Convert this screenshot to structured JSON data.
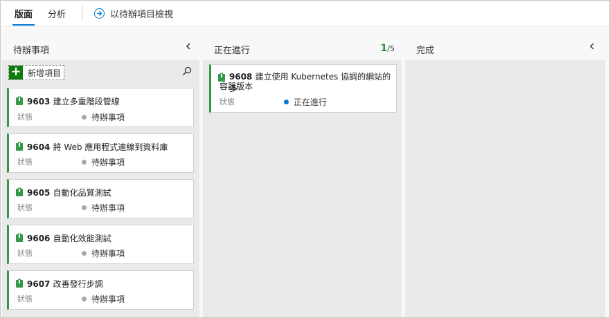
{
  "tabs": {
    "board": "版面",
    "analytics": "分析"
  },
  "backlog_link": {
    "label": "以待辦項目檢視",
    "icon": "arrow-circle-right-icon"
  },
  "columns": {
    "backlog": {
      "title": "待辦事項",
      "add_label": "新增項目"
    },
    "in_progress": {
      "title": "正在進行",
      "wip_current": "1",
      "wip_limit": "/5"
    },
    "done": {
      "title": "完成"
    }
  },
  "state_label": "狀態",
  "backlog_cards": [
    {
      "id": "9603",
      "title": "建立多重階段管線",
      "state": "待辦事項"
    },
    {
      "id": "9604",
      "title": "將 Web 應用程式連線到資料庫",
      "state": "待辦事項"
    },
    {
      "id": "9605",
      "title": "自動化品質測試",
      "state": "待辦事項"
    },
    {
      "id": "9606",
      "title": "自動化效能測試",
      "state": "待辦事項"
    },
    {
      "id": "9607",
      "title": "改善發行步調",
      "state": "待辦事項"
    }
  ],
  "progress_cards": [
    {
      "id": "9608",
      "title_line1": "建立使用 Kubernetes 協調的網站的多",
      "title_line2": "容器版本",
      "state": "正在進行"
    }
  ],
  "colors": {
    "accent": "#0078d4",
    "card_bar": "#339947",
    "wip_green": "#2e8b2e",
    "add_green": "#107c10",
    "state_backlog_dot": "#a6a6a6",
    "state_progress_dot": "#0078d4"
  }
}
